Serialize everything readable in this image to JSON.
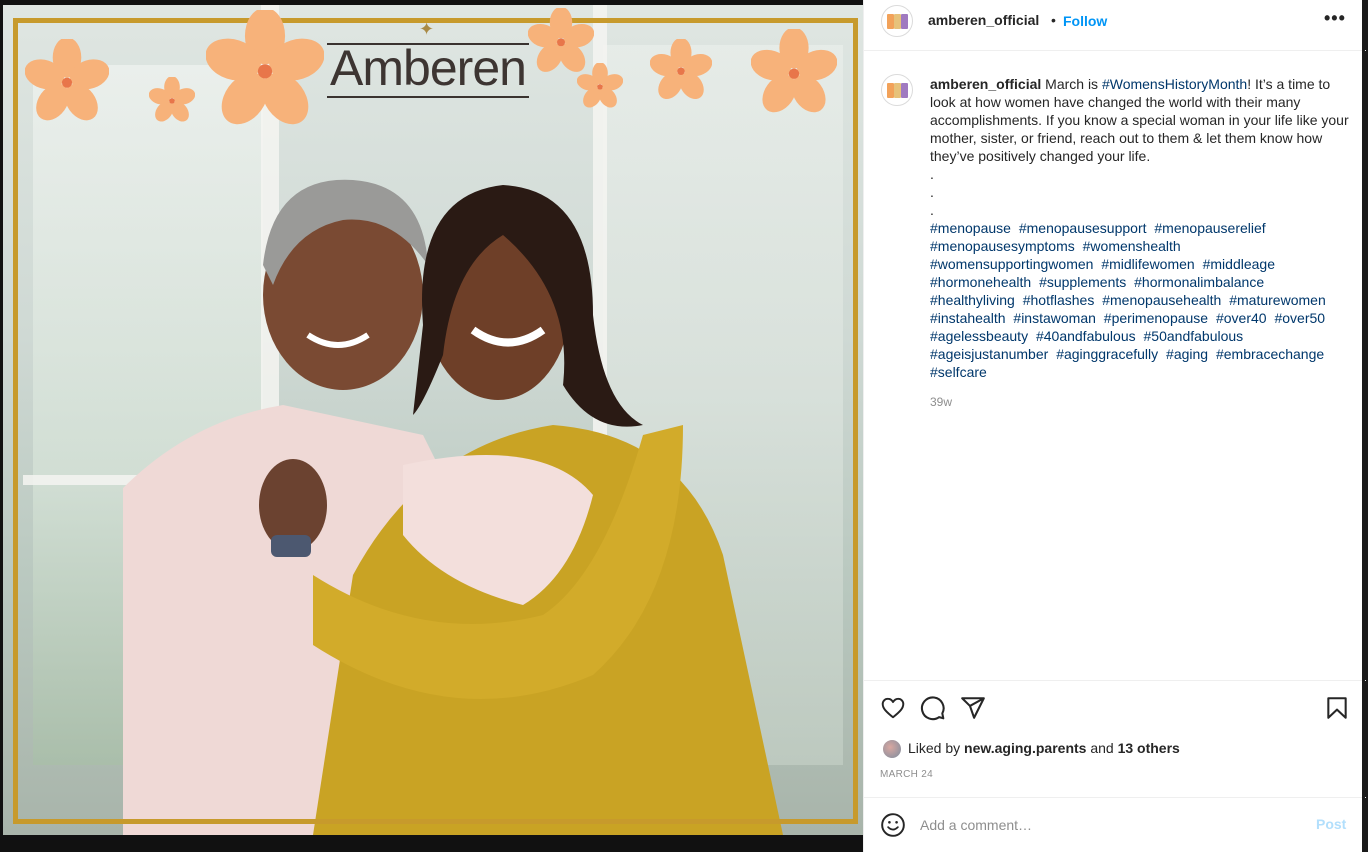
{
  "media": {
    "brand_logo_text": "Amberen"
  },
  "header": {
    "username": "amberen_official",
    "separator": "•",
    "follow_label": "Follow",
    "more_label": "•••"
  },
  "caption": {
    "username": "amberen_official",
    "text_before": "March is ",
    "tag": "#WomensHistoryMonth",
    "text_after": "! It’s a time to look at how women have changed the world with their many accomplishments. If you know a special woman in your life like your mother, sister, or friend, reach out to them & let them know how they’ve positively changed your life.",
    "dots": [
      ".",
      ".",
      "."
    ],
    "hashtags": [
      "#menopause",
      "#menopausesupport",
      "#menopauserelief",
      "#menopausesymptoms",
      "#womenshealth",
      "#womensupportingwomen",
      "#midlifewomen",
      "#middleage",
      "#hormonehealth",
      "#supplements",
      "#hormonalimbalance",
      "#healthyliving",
      "#hotflashes",
      "#menopausehealth",
      "#maturewomen",
      "#instahealth",
      "#instawoman",
      "#perimenopause",
      "#over40",
      "#over50",
      "#agelessbeauty",
      "#40andfabulous",
      "#50andfabulous",
      "#ageisjustanumber",
      "#aginggracefully",
      "#aging",
      "#embracechange",
      "#selfcare"
    ],
    "time_ago": "39w"
  },
  "actions": {
    "like_icon": "heart-icon",
    "comment_icon": "comment-icon",
    "share_icon": "paper-plane-icon",
    "save_icon": "bookmark-icon"
  },
  "likes": {
    "prefix": "Liked by",
    "user": "new.aging.parents",
    "middle": "and",
    "others": "13 others"
  },
  "post_date": "MARCH 24",
  "comment": {
    "placeholder": "Add a comment…",
    "post_label": "Post",
    "emoji_icon": "smiley-icon"
  },
  "colors": {
    "link": "#00376b",
    "follow": "#0095f6",
    "post_disabled": "#b2dffc",
    "frame_gold": "#c79a2c",
    "flower_orange": "#f7b27a"
  }
}
